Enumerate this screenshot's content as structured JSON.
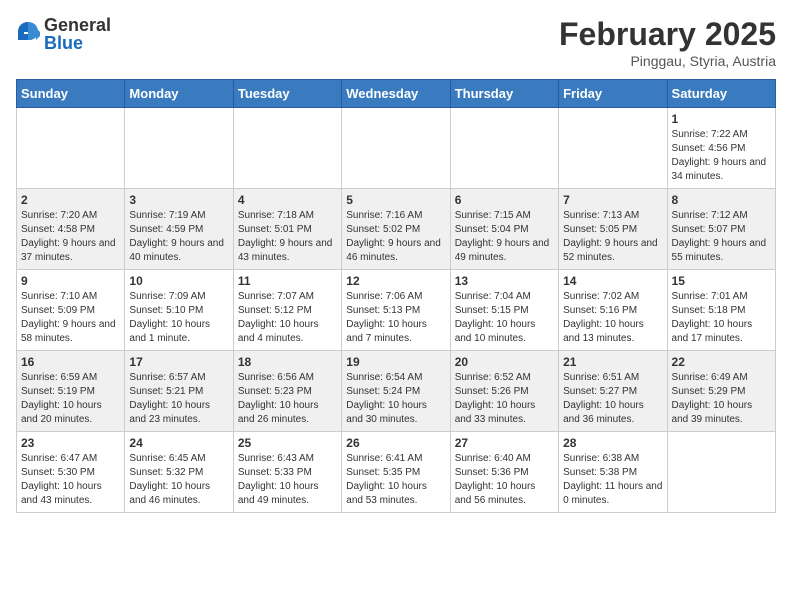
{
  "header": {
    "logo": {
      "general": "General",
      "blue": "Blue"
    },
    "title": "February 2025",
    "location": "Pinggau, Styria, Austria"
  },
  "days_of_week": [
    "Sunday",
    "Monday",
    "Tuesday",
    "Wednesday",
    "Thursday",
    "Friday",
    "Saturday"
  ],
  "weeks": [
    {
      "shaded": false,
      "days": [
        {
          "num": "",
          "info": ""
        },
        {
          "num": "",
          "info": ""
        },
        {
          "num": "",
          "info": ""
        },
        {
          "num": "",
          "info": ""
        },
        {
          "num": "",
          "info": ""
        },
        {
          "num": "",
          "info": ""
        },
        {
          "num": "1",
          "info": "Sunrise: 7:22 AM\nSunset: 4:56 PM\nDaylight: 9 hours and 34 minutes."
        }
      ]
    },
    {
      "shaded": true,
      "days": [
        {
          "num": "2",
          "info": "Sunrise: 7:20 AM\nSunset: 4:58 PM\nDaylight: 9 hours and 37 minutes."
        },
        {
          "num": "3",
          "info": "Sunrise: 7:19 AM\nSunset: 4:59 PM\nDaylight: 9 hours and 40 minutes."
        },
        {
          "num": "4",
          "info": "Sunrise: 7:18 AM\nSunset: 5:01 PM\nDaylight: 9 hours and 43 minutes."
        },
        {
          "num": "5",
          "info": "Sunrise: 7:16 AM\nSunset: 5:02 PM\nDaylight: 9 hours and 46 minutes."
        },
        {
          "num": "6",
          "info": "Sunrise: 7:15 AM\nSunset: 5:04 PM\nDaylight: 9 hours and 49 minutes."
        },
        {
          "num": "7",
          "info": "Sunrise: 7:13 AM\nSunset: 5:05 PM\nDaylight: 9 hours and 52 minutes."
        },
        {
          "num": "8",
          "info": "Sunrise: 7:12 AM\nSunset: 5:07 PM\nDaylight: 9 hours and 55 minutes."
        }
      ]
    },
    {
      "shaded": false,
      "days": [
        {
          "num": "9",
          "info": "Sunrise: 7:10 AM\nSunset: 5:09 PM\nDaylight: 9 hours and 58 minutes."
        },
        {
          "num": "10",
          "info": "Sunrise: 7:09 AM\nSunset: 5:10 PM\nDaylight: 10 hours and 1 minute."
        },
        {
          "num": "11",
          "info": "Sunrise: 7:07 AM\nSunset: 5:12 PM\nDaylight: 10 hours and 4 minutes."
        },
        {
          "num": "12",
          "info": "Sunrise: 7:06 AM\nSunset: 5:13 PM\nDaylight: 10 hours and 7 minutes."
        },
        {
          "num": "13",
          "info": "Sunrise: 7:04 AM\nSunset: 5:15 PM\nDaylight: 10 hours and 10 minutes."
        },
        {
          "num": "14",
          "info": "Sunrise: 7:02 AM\nSunset: 5:16 PM\nDaylight: 10 hours and 13 minutes."
        },
        {
          "num": "15",
          "info": "Sunrise: 7:01 AM\nSunset: 5:18 PM\nDaylight: 10 hours and 17 minutes."
        }
      ]
    },
    {
      "shaded": true,
      "days": [
        {
          "num": "16",
          "info": "Sunrise: 6:59 AM\nSunset: 5:19 PM\nDaylight: 10 hours and 20 minutes."
        },
        {
          "num": "17",
          "info": "Sunrise: 6:57 AM\nSunset: 5:21 PM\nDaylight: 10 hours and 23 minutes."
        },
        {
          "num": "18",
          "info": "Sunrise: 6:56 AM\nSunset: 5:23 PM\nDaylight: 10 hours and 26 minutes."
        },
        {
          "num": "19",
          "info": "Sunrise: 6:54 AM\nSunset: 5:24 PM\nDaylight: 10 hours and 30 minutes."
        },
        {
          "num": "20",
          "info": "Sunrise: 6:52 AM\nSunset: 5:26 PM\nDaylight: 10 hours and 33 minutes."
        },
        {
          "num": "21",
          "info": "Sunrise: 6:51 AM\nSunset: 5:27 PM\nDaylight: 10 hours and 36 minutes."
        },
        {
          "num": "22",
          "info": "Sunrise: 6:49 AM\nSunset: 5:29 PM\nDaylight: 10 hours and 39 minutes."
        }
      ]
    },
    {
      "shaded": false,
      "days": [
        {
          "num": "23",
          "info": "Sunrise: 6:47 AM\nSunset: 5:30 PM\nDaylight: 10 hours and 43 minutes."
        },
        {
          "num": "24",
          "info": "Sunrise: 6:45 AM\nSunset: 5:32 PM\nDaylight: 10 hours and 46 minutes."
        },
        {
          "num": "25",
          "info": "Sunrise: 6:43 AM\nSunset: 5:33 PM\nDaylight: 10 hours and 49 minutes."
        },
        {
          "num": "26",
          "info": "Sunrise: 6:41 AM\nSunset: 5:35 PM\nDaylight: 10 hours and 53 minutes."
        },
        {
          "num": "27",
          "info": "Sunrise: 6:40 AM\nSunset: 5:36 PM\nDaylight: 10 hours and 56 minutes."
        },
        {
          "num": "28",
          "info": "Sunrise: 6:38 AM\nSunset: 5:38 PM\nDaylight: 11 hours and 0 minutes."
        },
        {
          "num": "",
          "info": ""
        }
      ]
    }
  ]
}
